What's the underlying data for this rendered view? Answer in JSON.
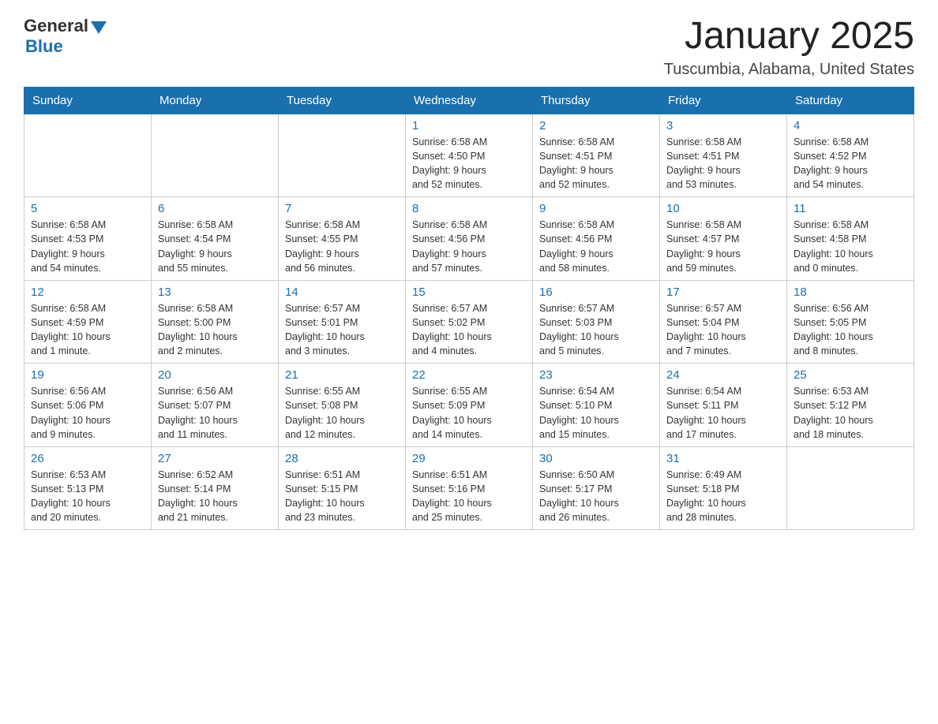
{
  "header": {
    "logo_general": "General",
    "logo_blue": "Blue",
    "month_title": "January 2025",
    "location": "Tuscumbia, Alabama, United States"
  },
  "days_of_week": [
    "Sunday",
    "Monday",
    "Tuesday",
    "Wednesday",
    "Thursday",
    "Friday",
    "Saturday"
  ],
  "weeks": [
    [
      {
        "day": "",
        "info": ""
      },
      {
        "day": "",
        "info": ""
      },
      {
        "day": "",
        "info": ""
      },
      {
        "day": "1",
        "info": "Sunrise: 6:58 AM\nSunset: 4:50 PM\nDaylight: 9 hours\nand 52 minutes."
      },
      {
        "day": "2",
        "info": "Sunrise: 6:58 AM\nSunset: 4:51 PM\nDaylight: 9 hours\nand 52 minutes."
      },
      {
        "day": "3",
        "info": "Sunrise: 6:58 AM\nSunset: 4:51 PM\nDaylight: 9 hours\nand 53 minutes."
      },
      {
        "day": "4",
        "info": "Sunrise: 6:58 AM\nSunset: 4:52 PM\nDaylight: 9 hours\nand 54 minutes."
      }
    ],
    [
      {
        "day": "5",
        "info": "Sunrise: 6:58 AM\nSunset: 4:53 PM\nDaylight: 9 hours\nand 54 minutes."
      },
      {
        "day": "6",
        "info": "Sunrise: 6:58 AM\nSunset: 4:54 PM\nDaylight: 9 hours\nand 55 minutes."
      },
      {
        "day": "7",
        "info": "Sunrise: 6:58 AM\nSunset: 4:55 PM\nDaylight: 9 hours\nand 56 minutes."
      },
      {
        "day": "8",
        "info": "Sunrise: 6:58 AM\nSunset: 4:56 PM\nDaylight: 9 hours\nand 57 minutes."
      },
      {
        "day": "9",
        "info": "Sunrise: 6:58 AM\nSunset: 4:56 PM\nDaylight: 9 hours\nand 58 minutes."
      },
      {
        "day": "10",
        "info": "Sunrise: 6:58 AM\nSunset: 4:57 PM\nDaylight: 9 hours\nand 59 minutes."
      },
      {
        "day": "11",
        "info": "Sunrise: 6:58 AM\nSunset: 4:58 PM\nDaylight: 10 hours\nand 0 minutes."
      }
    ],
    [
      {
        "day": "12",
        "info": "Sunrise: 6:58 AM\nSunset: 4:59 PM\nDaylight: 10 hours\nand 1 minute."
      },
      {
        "day": "13",
        "info": "Sunrise: 6:58 AM\nSunset: 5:00 PM\nDaylight: 10 hours\nand 2 minutes."
      },
      {
        "day": "14",
        "info": "Sunrise: 6:57 AM\nSunset: 5:01 PM\nDaylight: 10 hours\nand 3 minutes."
      },
      {
        "day": "15",
        "info": "Sunrise: 6:57 AM\nSunset: 5:02 PM\nDaylight: 10 hours\nand 4 minutes."
      },
      {
        "day": "16",
        "info": "Sunrise: 6:57 AM\nSunset: 5:03 PM\nDaylight: 10 hours\nand 5 minutes."
      },
      {
        "day": "17",
        "info": "Sunrise: 6:57 AM\nSunset: 5:04 PM\nDaylight: 10 hours\nand 7 minutes."
      },
      {
        "day": "18",
        "info": "Sunrise: 6:56 AM\nSunset: 5:05 PM\nDaylight: 10 hours\nand 8 minutes."
      }
    ],
    [
      {
        "day": "19",
        "info": "Sunrise: 6:56 AM\nSunset: 5:06 PM\nDaylight: 10 hours\nand 9 minutes."
      },
      {
        "day": "20",
        "info": "Sunrise: 6:56 AM\nSunset: 5:07 PM\nDaylight: 10 hours\nand 11 minutes."
      },
      {
        "day": "21",
        "info": "Sunrise: 6:55 AM\nSunset: 5:08 PM\nDaylight: 10 hours\nand 12 minutes."
      },
      {
        "day": "22",
        "info": "Sunrise: 6:55 AM\nSunset: 5:09 PM\nDaylight: 10 hours\nand 14 minutes."
      },
      {
        "day": "23",
        "info": "Sunrise: 6:54 AM\nSunset: 5:10 PM\nDaylight: 10 hours\nand 15 minutes."
      },
      {
        "day": "24",
        "info": "Sunrise: 6:54 AM\nSunset: 5:11 PM\nDaylight: 10 hours\nand 17 minutes."
      },
      {
        "day": "25",
        "info": "Sunrise: 6:53 AM\nSunset: 5:12 PM\nDaylight: 10 hours\nand 18 minutes."
      }
    ],
    [
      {
        "day": "26",
        "info": "Sunrise: 6:53 AM\nSunset: 5:13 PM\nDaylight: 10 hours\nand 20 minutes."
      },
      {
        "day": "27",
        "info": "Sunrise: 6:52 AM\nSunset: 5:14 PM\nDaylight: 10 hours\nand 21 minutes."
      },
      {
        "day": "28",
        "info": "Sunrise: 6:51 AM\nSunset: 5:15 PM\nDaylight: 10 hours\nand 23 minutes."
      },
      {
        "day": "29",
        "info": "Sunrise: 6:51 AM\nSunset: 5:16 PM\nDaylight: 10 hours\nand 25 minutes."
      },
      {
        "day": "30",
        "info": "Sunrise: 6:50 AM\nSunset: 5:17 PM\nDaylight: 10 hours\nand 26 minutes."
      },
      {
        "day": "31",
        "info": "Sunrise: 6:49 AM\nSunset: 5:18 PM\nDaylight: 10 hours\nand 28 minutes."
      },
      {
        "day": "",
        "info": ""
      }
    ]
  ]
}
